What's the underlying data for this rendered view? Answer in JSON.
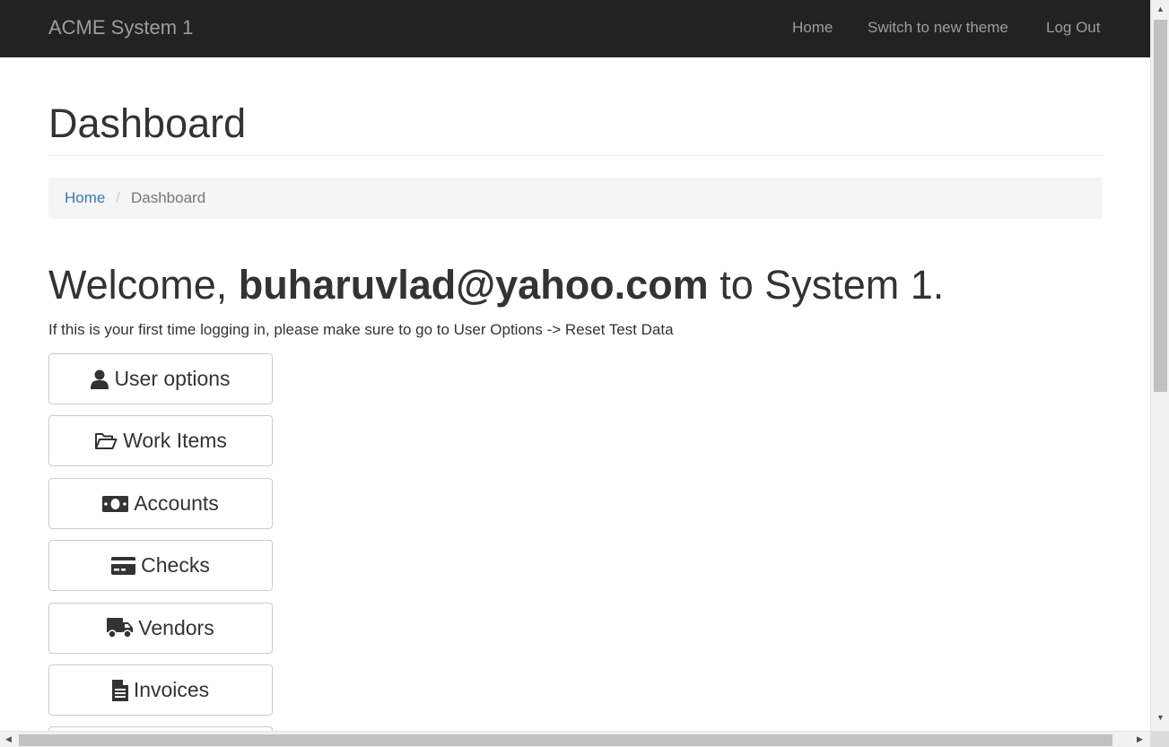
{
  "navbar": {
    "brand": "ACME System 1",
    "links": [
      "Home",
      "Switch to new theme",
      "Log Out"
    ]
  },
  "page": {
    "title": "Dashboard"
  },
  "breadcrumb": {
    "home": "Home",
    "separator": "/",
    "current": "Dashboard"
  },
  "welcome": {
    "prefix": "Welcome, ",
    "user": "buharuvlad@yahoo.com",
    "suffix": " to System 1.",
    "hint": "If this is your first time logging in, please make sure to go to User Options -> Reset Test Data"
  },
  "buttons": [
    {
      "label": "User options",
      "icon": "user-icon"
    },
    {
      "label": "Work Items",
      "icon": "folder-open-icon"
    },
    {
      "label": "Accounts",
      "icon": "money-icon"
    },
    {
      "label": "Checks",
      "icon": "credit-card-icon"
    },
    {
      "label": "Vendors",
      "icon": "truck-icon"
    },
    {
      "label": "Invoices",
      "icon": "file-text-icon"
    }
  ],
  "colors": {
    "navbar_bg": "#222222",
    "nav_text": "#9d9d9d",
    "link": "#337ab7",
    "breadcrumb_bg": "#f5f5f5"
  }
}
